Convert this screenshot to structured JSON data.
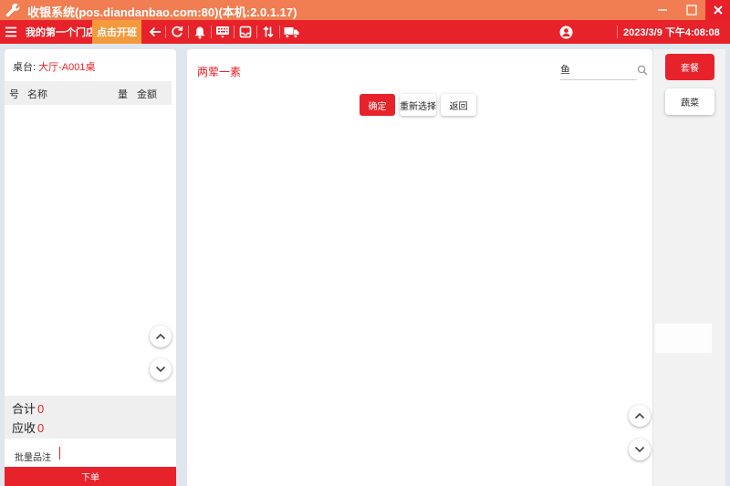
{
  "window": {
    "title": "收银系统(pos.diandanbao.com:80)(本机:2.0.1.17)"
  },
  "toolbar": {
    "store_name": "我的第一个门店",
    "shift_label": "点击开班",
    "datetime": "2023/3/9 下午4:08:08"
  },
  "order": {
    "table_label": "桌台:",
    "table_value": "大厅-A001桌",
    "columns": {
      "no": "号",
      "name": "名称",
      "qty": "量",
      "amount": "金额"
    },
    "total_label": "合计",
    "total_value": "0",
    "receivable_label": "应收",
    "receivable_value": "0",
    "remark_label": "批量品注",
    "submit_label": "下单"
  },
  "menu": {
    "group_title": "两荤一素",
    "search_value": "鱼",
    "actions": {
      "confirm": "确定",
      "reselect": "重新选择",
      "back": "返回"
    }
  },
  "categories": [
    {
      "label": "套餐",
      "active": true
    },
    {
      "label": "蔬菜",
      "active": false
    }
  ],
  "colors": {
    "titlebar": "#f07e52",
    "toolbar": "#e8222a",
    "shift_button": "#f29a3c",
    "accent": "#e8222a"
  }
}
